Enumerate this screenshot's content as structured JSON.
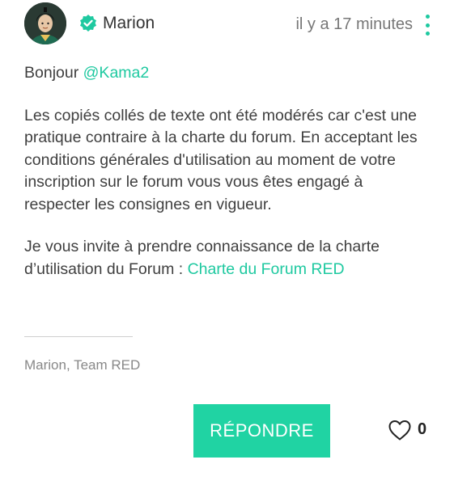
{
  "post": {
    "author": "Marion",
    "time": "il y a 17 minutes",
    "greeting_prefix": "Bonjour ",
    "mention": "@Kama2",
    "paragraph1": "Les copiés collés de texte ont été modérés car c'est une pratique contraire à la charte du forum. En acceptant les conditions générales d'utilisation au moment de votre inscription sur le forum vous vous êtes engagé à respecter les consignes en vigueur.",
    "paragraph2_text": "Je vous invite à prendre connaissance de la charte d’utilisation du Forum : ",
    "paragraph2_link": "Charte du Forum RED",
    "signature": "Marion, Team RED"
  },
  "actions": {
    "reply_label": "RÉPONDRE",
    "like_count": "0"
  },
  "colors": {
    "accent": "#1ec9a0",
    "button": "#20d3a3",
    "text": "#3f3f3f",
    "muted": "#888888"
  },
  "icons": {
    "avatar": "avatar-illustration",
    "verified": "verified-badge-icon",
    "more": "more-vertical-icon",
    "like": "heart-outline-icon"
  }
}
